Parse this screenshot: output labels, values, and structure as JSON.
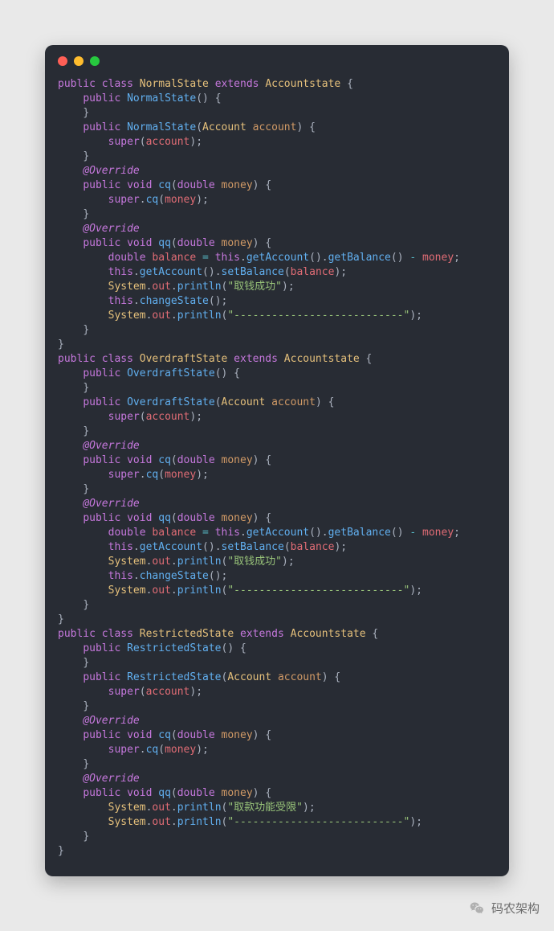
{
  "footer": {
    "label": "码农架构"
  },
  "code": {
    "classes": [
      {
        "name": "NormalState",
        "extends": "Accountstate",
        "ctor_noarg": "NormalState",
        "ctor_arg": {
          "name": "NormalState",
          "param_type": "Account",
          "param_name": "account",
          "super_arg": "account"
        },
        "cq": {
          "param_type": "double",
          "param_name": "money",
          "body_call": "cq",
          "body_arg": "money"
        },
        "qq": {
          "param_type": "double",
          "param_name": "money",
          "balance_expr": true,
          "println1": "\"取钱成功\"",
          "changeState": true,
          "println2": "\"---------------------------\""
        }
      },
      {
        "name": "OverdraftState",
        "extends": "Accountstate",
        "ctor_noarg": "OverdraftState",
        "ctor_arg": {
          "name": "OverdraftState",
          "param_type": "Account",
          "param_name": "account",
          "super_arg": "account"
        },
        "cq": {
          "param_type": "double",
          "param_name": "money",
          "body_call": "cq",
          "body_arg": "money"
        },
        "qq": {
          "param_type": "double",
          "param_name": "money",
          "balance_expr": true,
          "println1": "\"取钱成功\"",
          "changeState": true,
          "println2": "\"---------------------------\""
        }
      },
      {
        "name": "RestrictedState",
        "extends": "Accountstate",
        "ctor_noarg": "RestrictedState",
        "ctor_arg": {
          "name": "RestrictedState",
          "param_type": "Account",
          "param_name": "account",
          "super_arg": "account"
        },
        "cq": {
          "param_type": "double",
          "param_name": "money",
          "body_call": "cq",
          "body_arg": "money"
        },
        "qq": {
          "param_type": "double",
          "param_name": "money",
          "balance_expr": false,
          "println1": "\"取款功能受限\"",
          "changeState": false,
          "println2": "\"---------------------------\""
        }
      }
    ]
  }
}
